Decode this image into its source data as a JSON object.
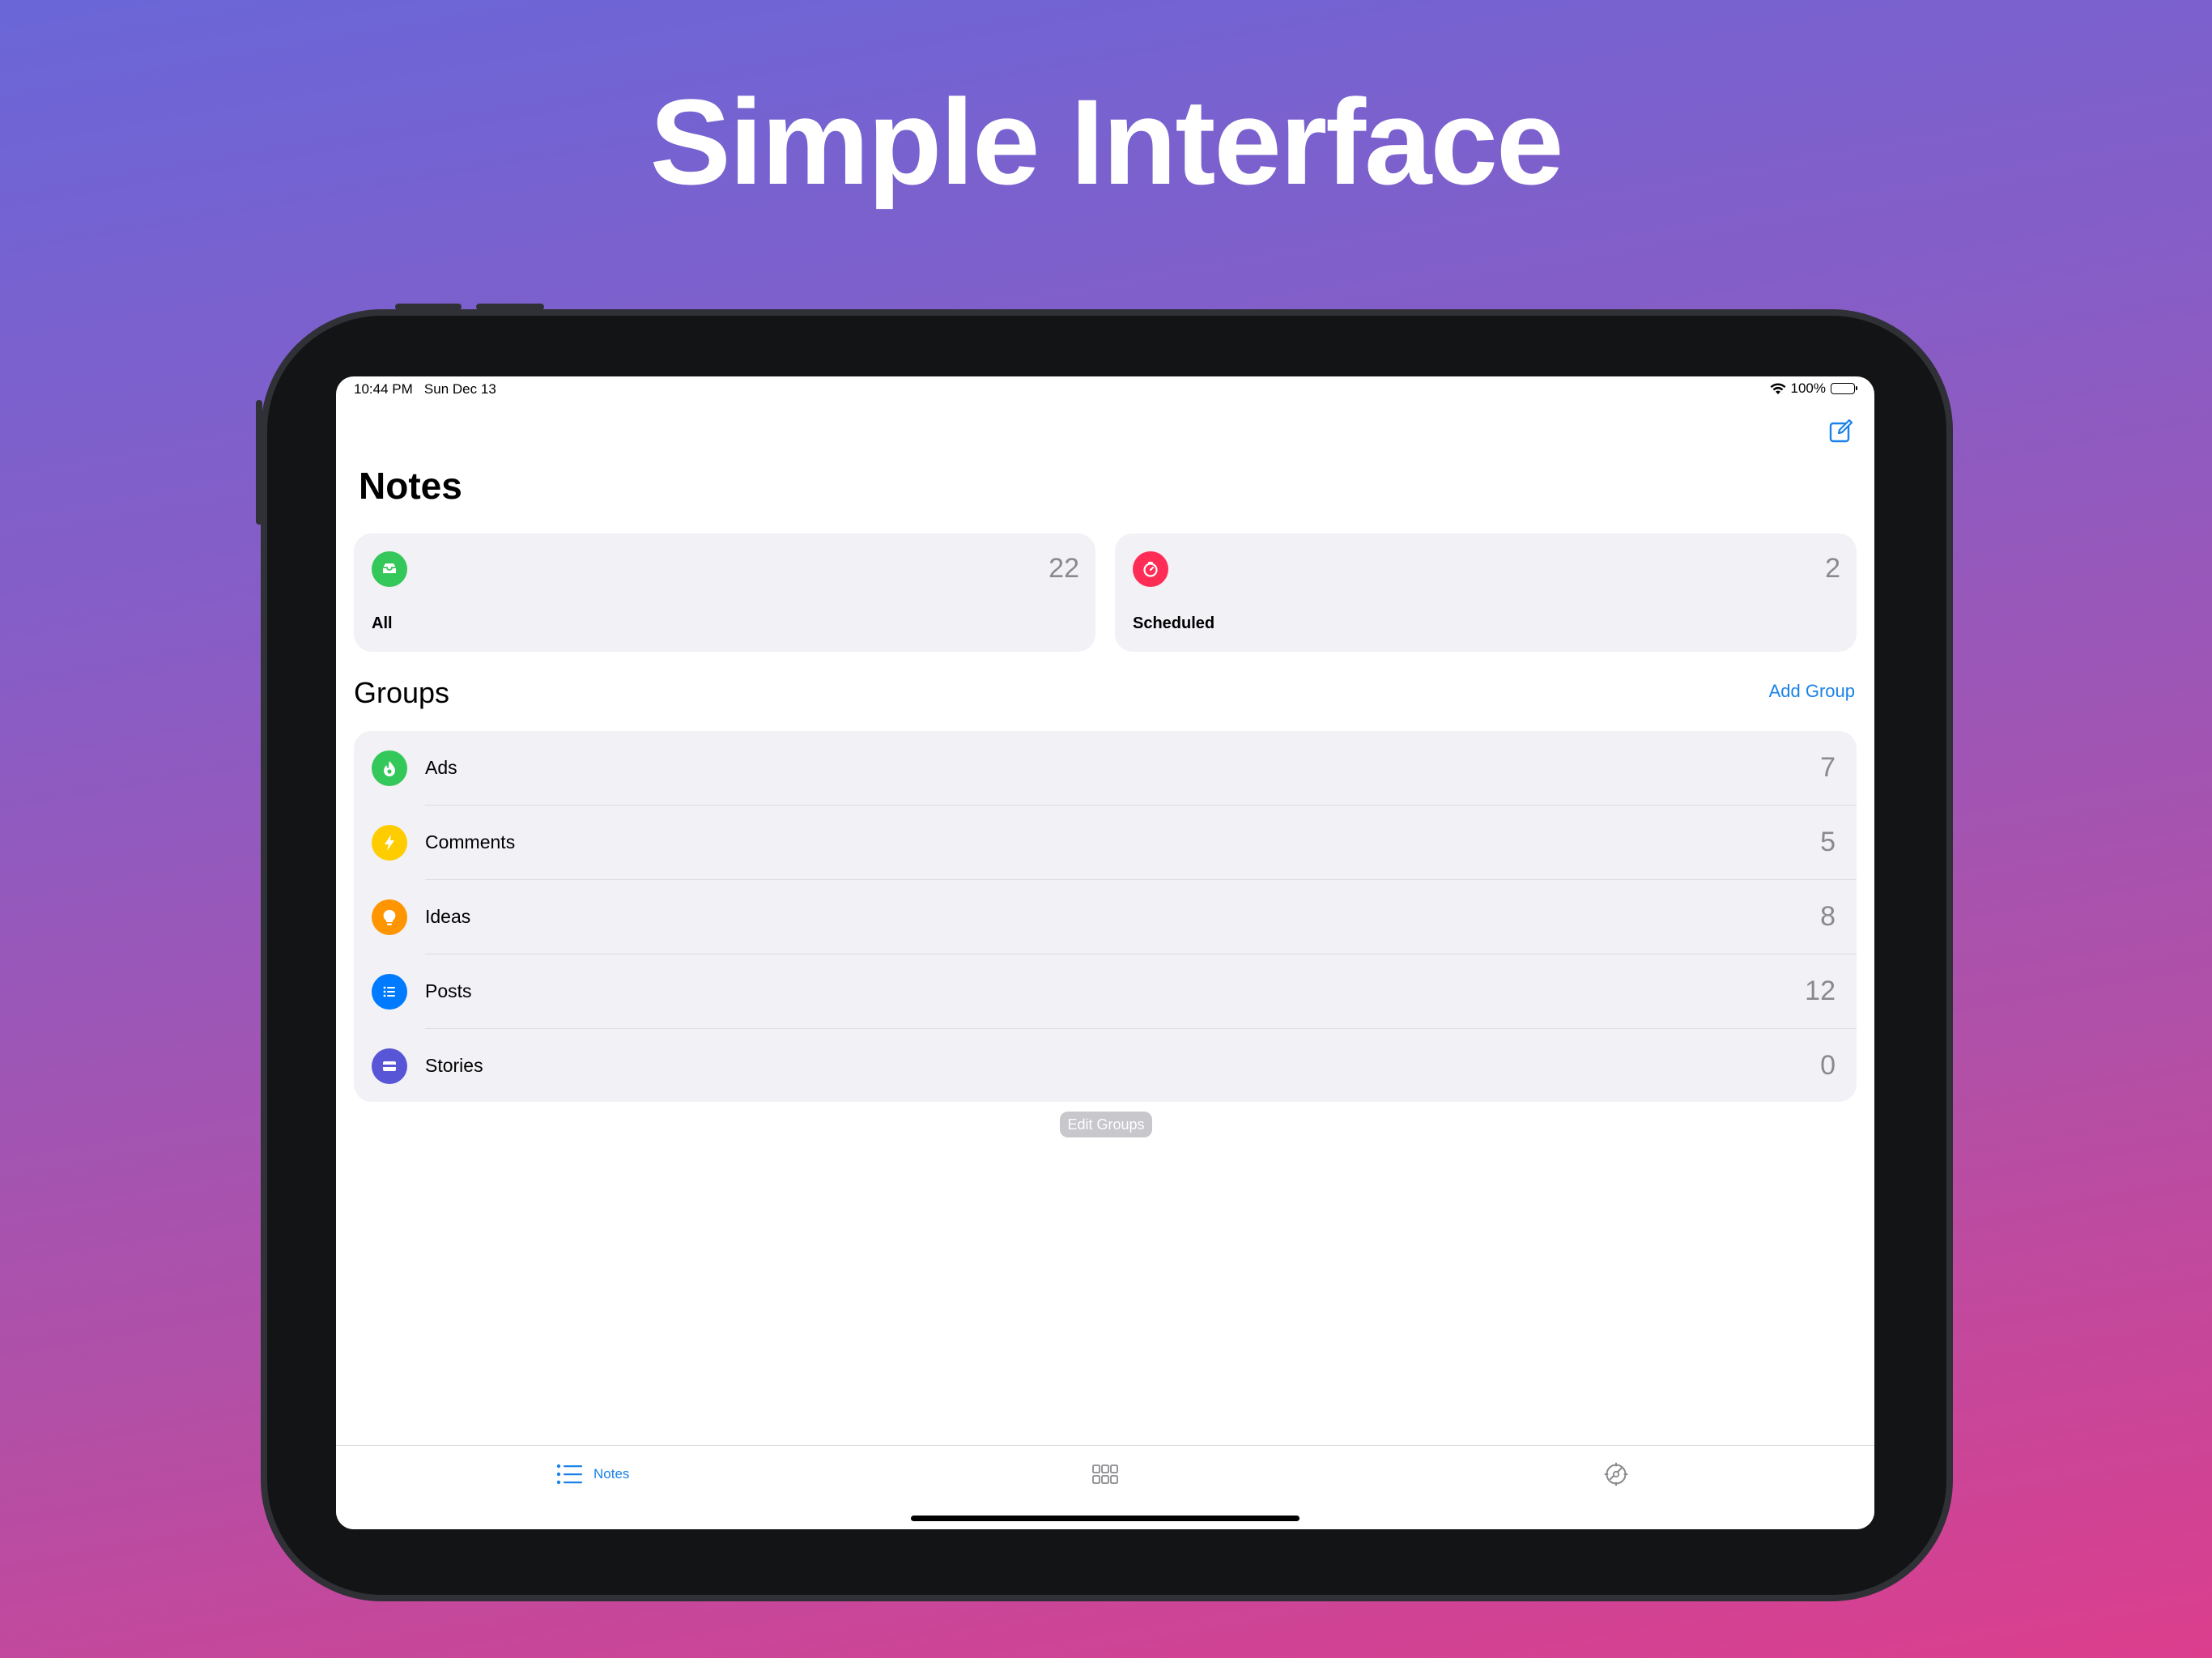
{
  "headline": "Simple Interface",
  "status_bar": {
    "time": "10:44 PM   Sun Dec 13",
    "battery": "100%"
  },
  "page_title": "Notes",
  "summary_cards": [
    {
      "label": "All",
      "count": "22",
      "icon": "tray-icon",
      "color": "#34c759"
    },
    {
      "label": "Scheduled",
      "count": "2",
      "icon": "timer-icon",
      "color": "#ff2d55"
    }
  ],
  "groups": {
    "title": "Groups",
    "add_label": "Add Group",
    "items": [
      {
        "name": "Ads",
        "count": "7",
        "icon": "flame-icon",
        "color": "#34c759"
      },
      {
        "name": "Comments",
        "count": "5",
        "icon": "bolt-icon",
        "color": "#ffcc00"
      },
      {
        "name": "Ideas",
        "count": "8",
        "icon": "lightbulb-icon",
        "color": "#ff9500"
      },
      {
        "name": "Posts",
        "count": "12",
        "icon": "list-icon",
        "color": "#007aff"
      },
      {
        "name": "Stories",
        "count": "0",
        "icon": "film-icon",
        "color": "#5856d6"
      }
    ],
    "edit_label": "Edit Groups"
  },
  "tabbar": {
    "notes_label": "Notes",
    "accent": "#1a82e8"
  }
}
